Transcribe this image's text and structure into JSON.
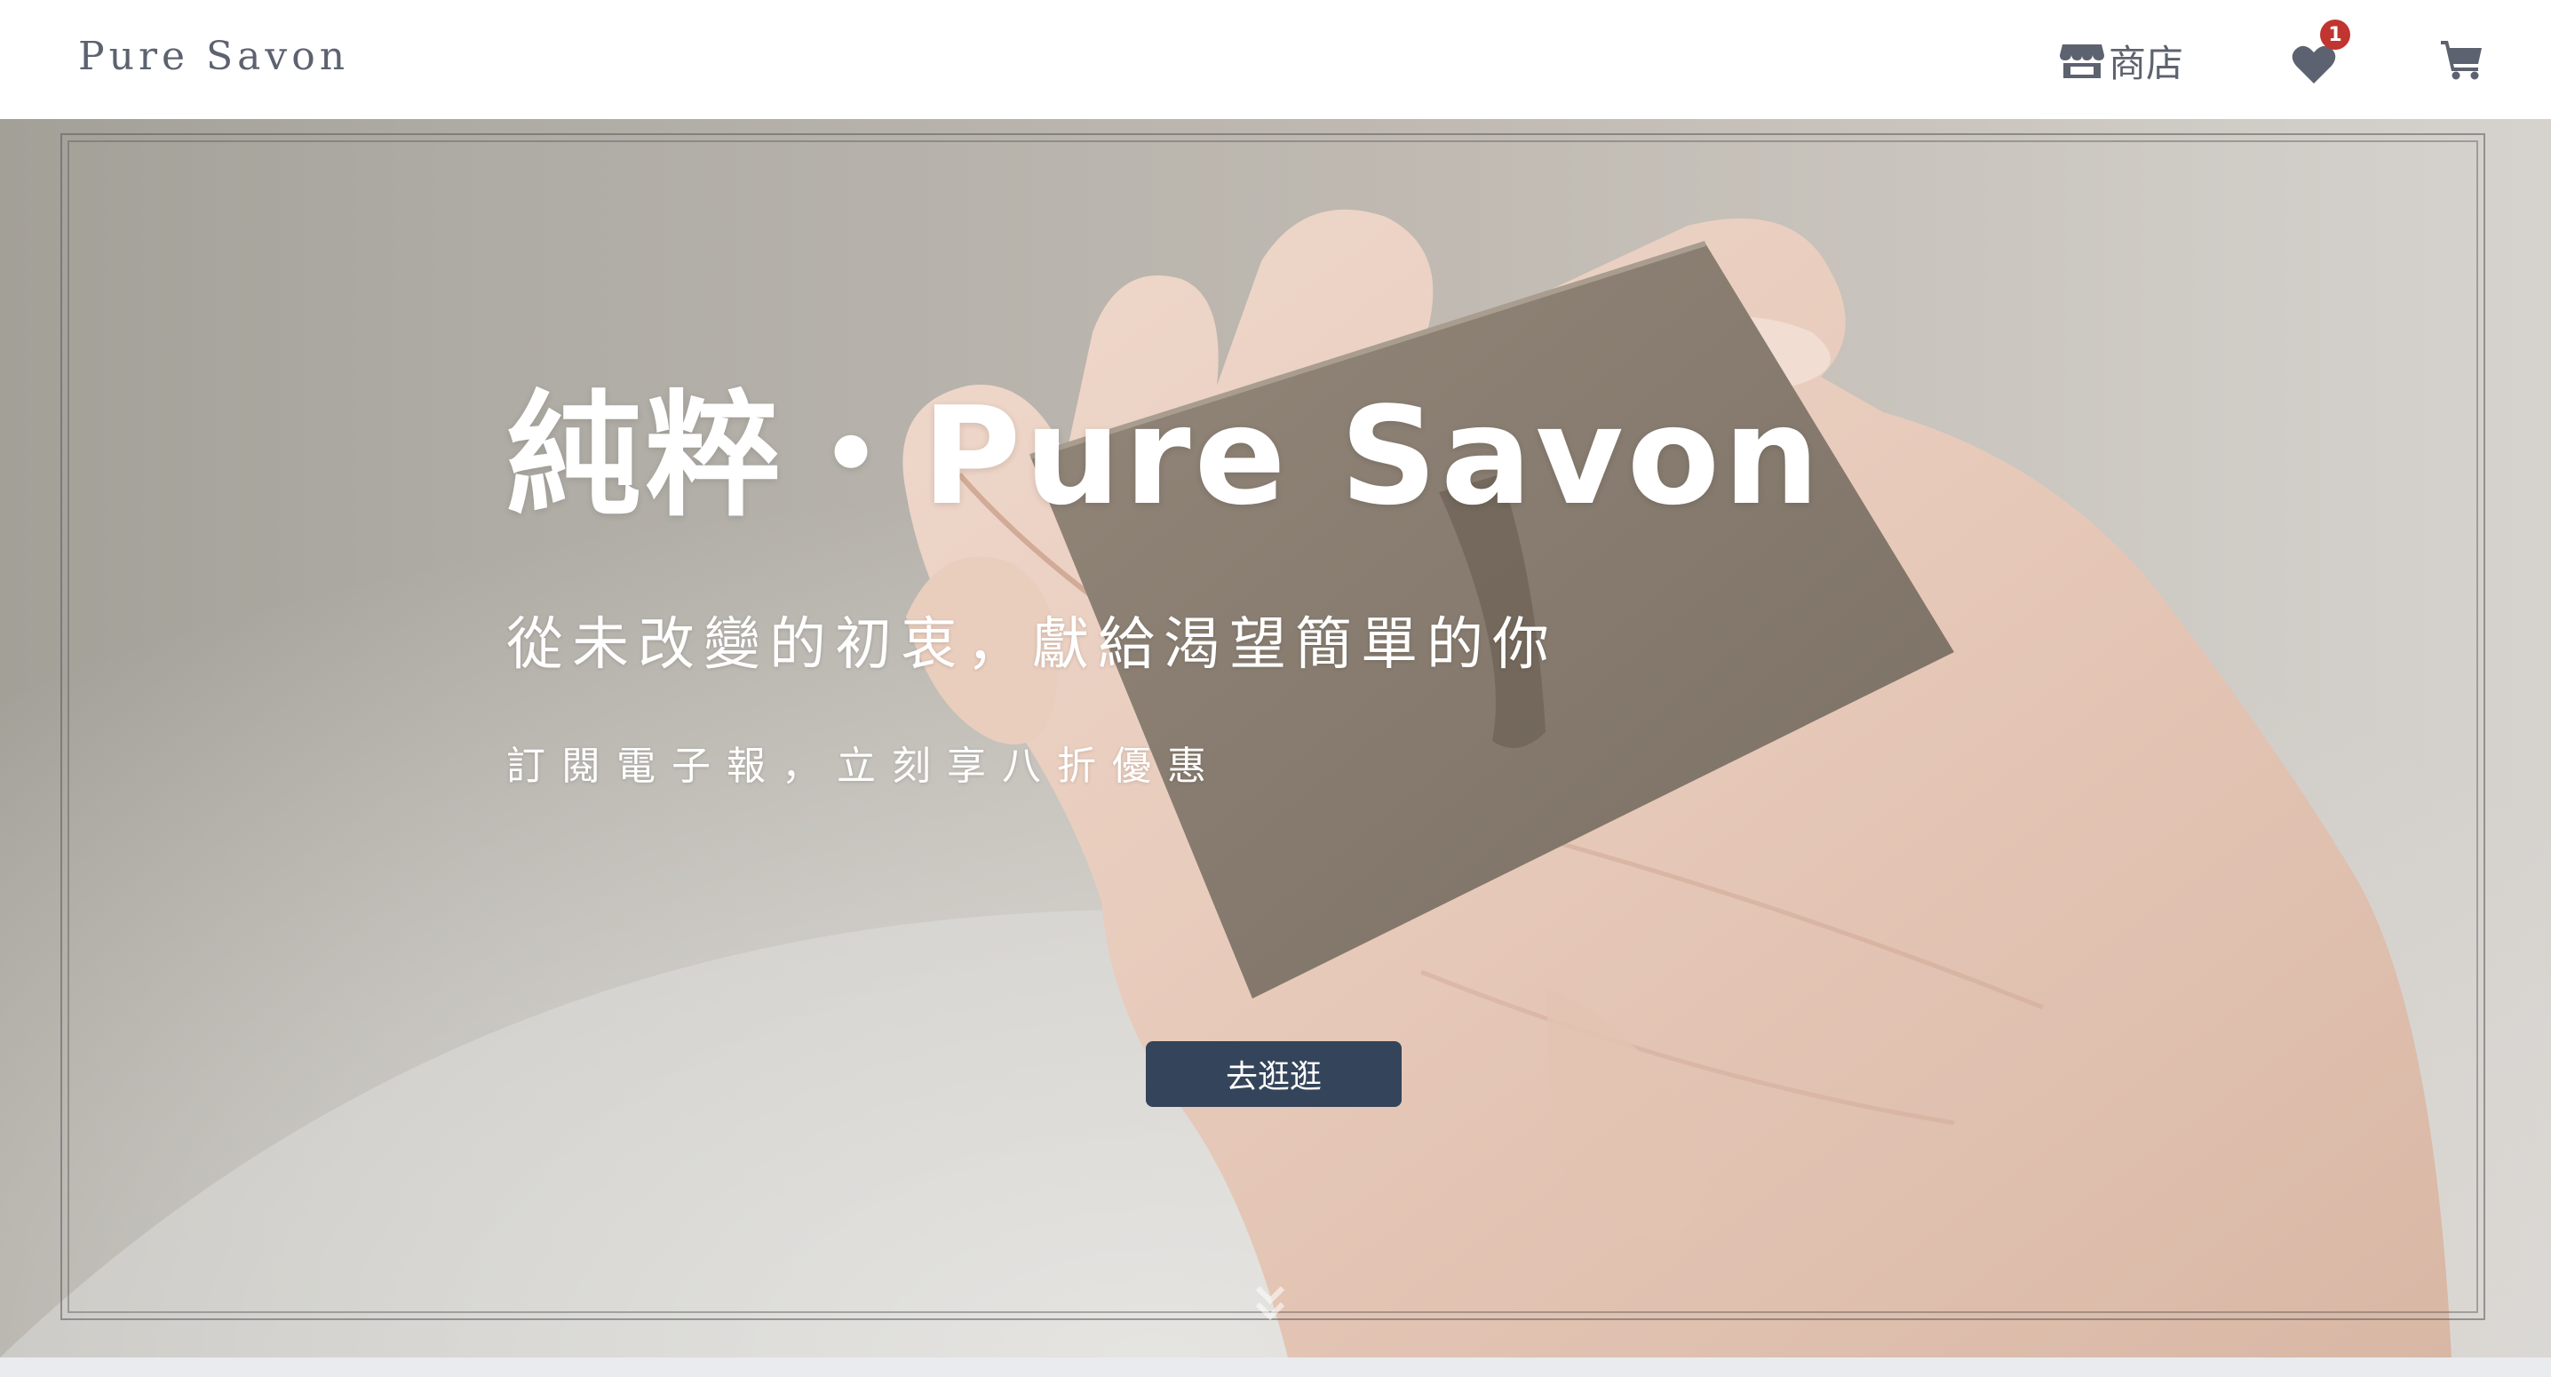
{
  "navbar": {
    "brand": "Pure Savon",
    "shop_label": "商店",
    "shop_icon": "store-icon",
    "favorites_icon": "heart-icon",
    "favorites_count": "1",
    "cart_icon": "cart-icon"
  },
  "hero": {
    "title": "純粹・Pure Savon",
    "subtitle": "從未改變的初衷，獻給渴望簡單的你",
    "promo": "訂閱電子報，立刻享八折優惠",
    "cta_label": "去逛逛",
    "scroll_icon": "double-chevron-down-icon",
    "image": "hands-holding-soap-photo"
  },
  "colors": {
    "brand_text": "#5d6270",
    "badge": "#c0352f",
    "cta_background": "#34445a",
    "hero_text": "#ffffff"
  }
}
